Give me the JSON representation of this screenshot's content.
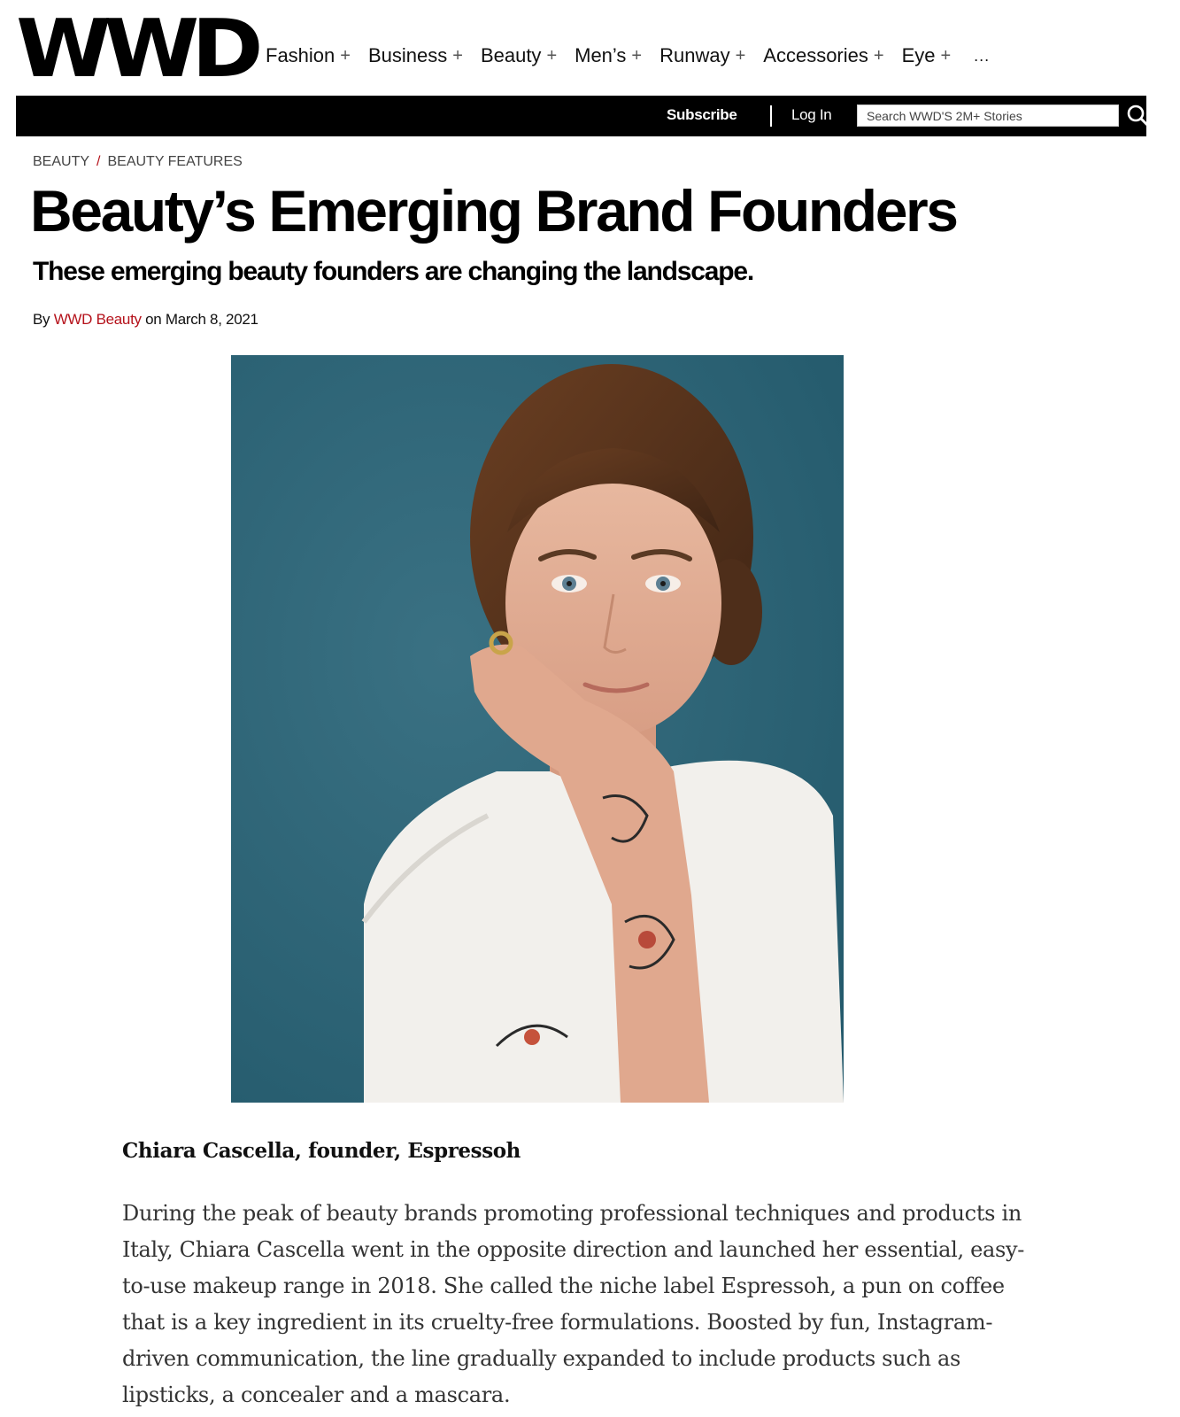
{
  "header": {
    "logo": "WWD",
    "nav": [
      {
        "label": "Fashion",
        "plus": "+"
      },
      {
        "label": "Business",
        "plus": "+"
      },
      {
        "label": "Beauty",
        "plus": "+"
      },
      {
        "label": "Men’s",
        "plus": "+"
      },
      {
        "label": "Runway",
        "plus": "+"
      },
      {
        "label": "Accessories",
        "plus": "+"
      },
      {
        "label": "Eye",
        "plus": "+"
      }
    ],
    "more": "..."
  },
  "topbar": {
    "subscribe": "Subscribe",
    "login": "Log In",
    "search_placeholder": "Search WWD'S 2M+ Stories",
    "search_icon": "search-icon"
  },
  "breadcrumb": {
    "section": "BEAUTY",
    "separator": "/",
    "subsection": "BEAUTY FEATURES"
  },
  "article": {
    "title": "Beauty’s Emerging Brand Founders",
    "subtitle": "These emerging beauty founders are changing the landscape.",
    "byline_prefix": "By",
    "author": "WWD Beauty",
    "byline_on": "on",
    "date": "March 8, 2021",
    "caption": "Chiara Cascella, founder, Espressoh",
    "body": "During the peak of beauty brands promoting professional techniques and products in Italy, Chiara Cascella went in the opposite direction and launched her essential, easy-to-use makeup range in 2018. She called the niche label Espressoh, a pun on coffee that is a key ingredient in its cruelty-free formulations. Boosted by fun, Instagram-driven communication, the line gradually expanded to include products such as lipsticks, a concealer and a mascara."
  },
  "colors": {
    "accent": "#b5121b",
    "topbar": "#000000",
    "photo_background": "#2c6478"
  }
}
